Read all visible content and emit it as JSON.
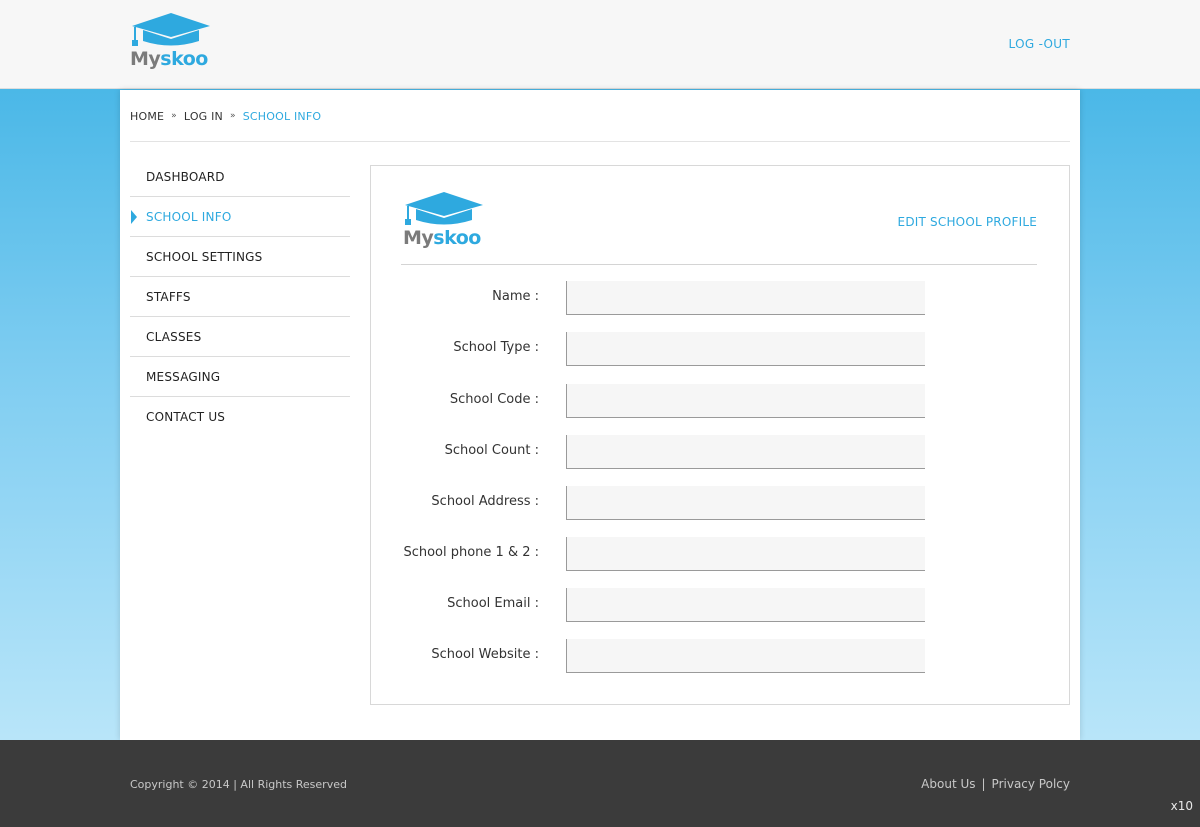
{
  "header": {
    "logo": {
      "text_my": "My",
      "text_skoo": "skoo",
      "icon": "graduation-cap-icon"
    },
    "logout_label": "LOG -OUT"
  },
  "breadcrumb": {
    "items": [
      "HOME",
      "LOG IN",
      "SCHOOL INFO"
    ],
    "separator": "»"
  },
  "sidebar": {
    "items": [
      {
        "label": "DASHBOARD",
        "active": false
      },
      {
        "label": "SCHOOL INFO",
        "active": true
      },
      {
        "label": "SCHOOL SETTINGS",
        "active": false
      },
      {
        "label": "STAFFS",
        "active": false
      },
      {
        "label": "CLASSES",
        "active": false
      },
      {
        "label": "MESSAGING",
        "active": false
      },
      {
        "label": "CONTACT US",
        "active": false
      }
    ]
  },
  "card": {
    "edit_label": "EDIT SCHOOL PROFILE",
    "fields": [
      {
        "label": "Name :",
        "value": ""
      },
      {
        "label": "School Type :",
        "value": ""
      },
      {
        "label": "School Code :",
        "value": ""
      },
      {
        "label": "School Count :",
        "value": ""
      },
      {
        "label": "School Address :",
        "value": ""
      },
      {
        "label": "School phone 1 & 2 :",
        "value": ""
      },
      {
        "label": "School Email :",
        "value": ""
      },
      {
        "label": "School Website :",
        "value": ""
      }
    ]
  },
  "footer": {
    "copyright": "Copyright © 2014 | All Rights Reserved",
    "about_label": "About Us",
    "divider": "|",
    "privacy_label": "Privacy Polcy"
  },
  "zoom_label": "x10",
  "colors": {
    "accent": "#2ea9df",
    "footer_bg": "#3b3b3b",
    "header_bg": "#f7f7f7"
  }
}
